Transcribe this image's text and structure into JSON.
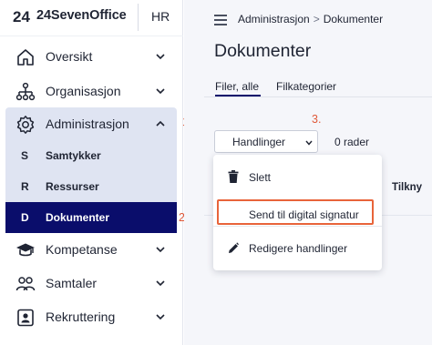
{
  "brand": {
    "name": "24SevenOffice",
    "initials": "HR"
  },
  "sidebar": {
    "items": [
      {
        "label": "Oversikt",
        "icon": "home-icon"
      },
      {
        "label": "Organisasjon",
        "icon": "org-chart-icon"
      },
      {
        "label": "Administrasjon",
        "icon": "gear-icon"
      },
      {
        "label": "Kompetanse",
        "icon": "graduation-cap-icon"
      },
      {
        "label": "Samtaler",
        "icon": "people-icon"
      },
      {
        "label": "Rekruttering",
        "icon": "id-card-icon"
      }
    ],
    "admin_sub": [
      {
        "letter": "S",
        "label": "Samtykker"
      },
      {
        "letter": "R",
        "label": "Ressurser"
      },
      {
        "letter": "D",
        "label": "Dokumenter"
      }
    ]
  },
  "steps": {
    "one": "1.",
    "two": "2.",
    "three": "3."
  },
  "main": {
    "breadcrumb": {
      "parent": "Administrasjon",
      "separator": ">",
      "current": "Dokumenter"
    },
    "title": "Dokumenter",
    "tabs": [
      {
        "label": "Filer, alle"
      },
      {
        "label": "Filkategorier"
      }
    ],
    "actions_label": "Handlinger",
    "row_count": "0 rader",
    "table_header_fragment": "Tilkny"
  },
  "dropdown": {
    "items": [
      {
        "label": "Slett",
        "icon": "trash-icon"
      },
      {
        "label": "Send til digital signatur",
        "icon": ""
      },
      {
        "label": "Redigere handlinger",
        "icon": "pencil-icon"
      }
    ]
  },
  "colors": {
    "accent": "#0a0d6b",
    "highlight": "#e8643a",
    "admin_bg": "#dfe4f2"
  }
}
